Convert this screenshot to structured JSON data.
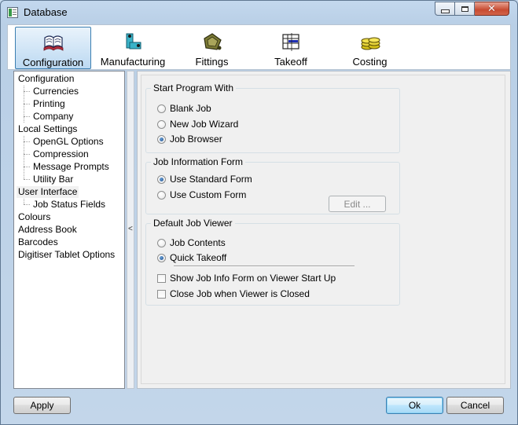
{
  "window": {
    "title": "Database",
    "minimize_symbol": "",
    "maximize_symbol": "",
    "close_symbol": "✕"
  },
  "toolbar": {
    "items": [
      {
        "label": "Configuration",
        "icon": "book-icon",
        "active": true
      },
      {
        "label": "Manufacturing",
        "icon": "manufacturing-icon",
        "active": false
      },
      {
        "label": "Fittings",
        "icon": "fittings-icon",
        "active": false
      },
      {
        "label": "Takeoff",
        "icon": "takeoff-icon",
        "active": false
      },
      {
        "label": "Costing",
        "icon": "coins-icon",
        "active": false
      }
    ]
  },
  "tree": {
    "nodes": [
      {
        "label": "Configuration",
        "level": 0
      },
      {
        "label": "Currencies",
        "level": 1
      },
      {
        "label": "Printing",
        "level": 1
      },
      {
        "label": "Company",
        "level": 1
      },
      {
        "label": "Local Settings",
        "level": 0
      },
      {
        "label": "OpenGL Options",
        "level": 1
      },
      {
        "label": "Compression",
        "level": 1
      },
      {
        "label": "Message Prompts",
        "level": 1
      },
      {
        "label": "Utility Bar",
        "level": 1
      },
      {
        "label": "User Interface",
        "level": 0,
        "selected": true
      },
      {
        "label": "Job Status Fields",
        "level": 1
      },
      {
        "label": "Colours",
        "level": 0
      },
      {
        "label": "Address Book",
        "level": 0
      },
      {
        "label": "Barcodes",
        "level": 0
      },
      {
        "label": "Digitiser Tablet Options",
        "level": 0
      }
    ]
  },
  "splitter": {
    "arrow": "<"
  },
  "start_program": {
    "title": "Start Program With",
    "options": [
      {
        "label": "Blank Job",
        "checked": false
      },
      {
        "label": "New Job Wizard",
        "checked": false
      },
      {
        "label": "Job Browser",
        "checked": true
      }
    ]
  },
  "job_info_form": {
    "title": "Job Information Form",
    "options": [
      {
        "label": "Use Standard Form",
        "checked": true
      },
      {
        "label": "Use Custom Form",
        "checked": false
      }
    ],
    "edit_label": "Edit ..."
  },
  "default_viewer": {
    "title": "Default Job Viewer",
    "options": [
      {
        "label": "Job Contents",
        "checked": false
      },
      {
        "label": "Quick Takeoff",
        "checked": true
      }
    ],
    "checkboxes": [
      {
        "label": "Show Job Info Form on Viewer Start Up",
        "checked": false
      },
      {
        "label": "Close Job when Viewer is Closed",
        "checked": false
      }
    ]
  },
  "buttons": {
    "apply": "Apply",
    "ok": "Ok",
    "cancel": "Cancel"
  },
  "colors": {
    "accent": "#3c7fb1",
    "radio_dot": "#1f4d8c",
    "close_button": "#c74a30"
  }
}
